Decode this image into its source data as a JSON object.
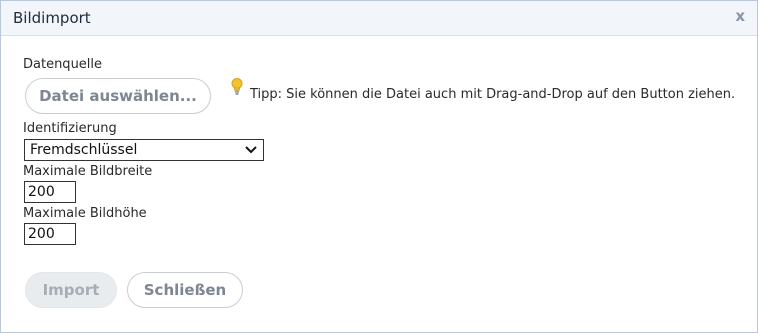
{
  "dialog": {
    "title": "Bildimport",
    "close_symbol": "x"
  },
  "source": {
    "label": "Datenquelle",
    "button_label": "Datei auswählen...",
    "tip_icon": "lightbulb-icon",
    "tip_text": "Tipp: Sie können die Datei auch mit Drag-and-Drop auf den Button ziehen."
  },
  "identification": {
    "label": "Identifizierung",
    "selected": "Fremdschlüssel"
  },
  "max_width": {
    "label": "Maximale Bildbreite",
    "value": "200"
  },
  "max_height": {
    "label": "Maximale Bildhöhe",
    "value": "200"
  },
  "footer": {
    "import_label": "Import",
    "close_label": "Schließen"
  },
  "colors": {
    "titlebar_bg": "#f2f6fb",
    "border": "#b8c7d9",
    "button_text": "#7d8691",
    "bulb": "#f2c230"
  }
}
